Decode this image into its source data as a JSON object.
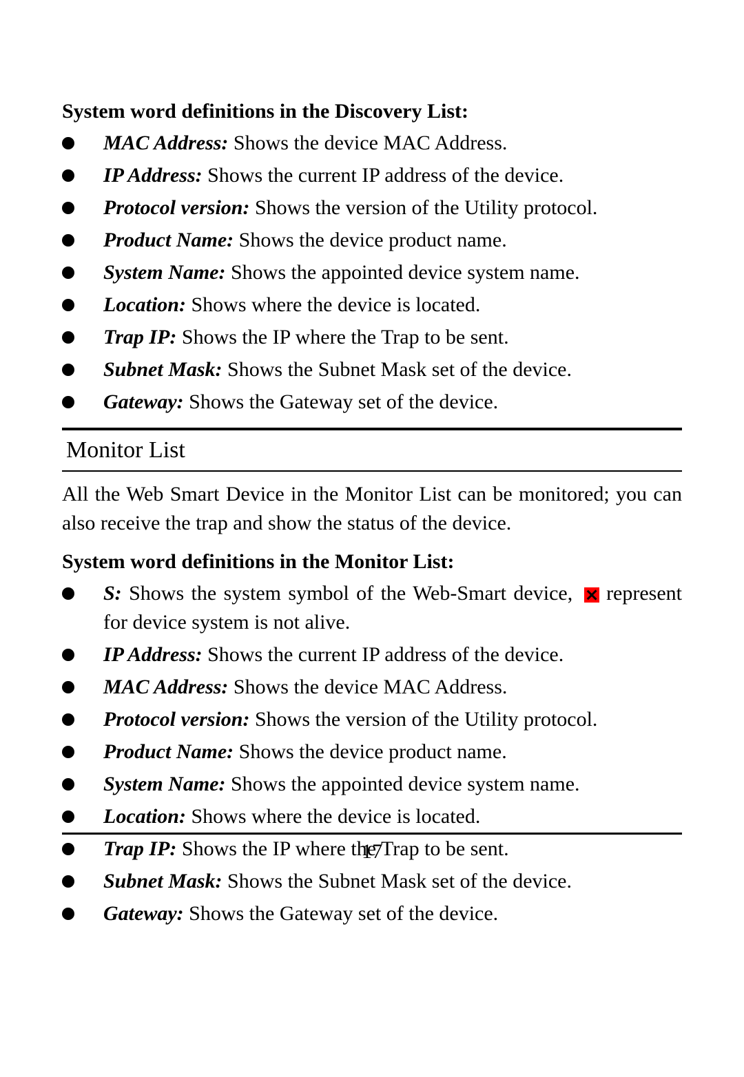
{
  "section1": {
    "title": "System word definitions in the Discovery List:",
    "items": [
      {
        "term": "MAC Address:",
        "desc": " Shows the device MAC Address."
      },
      {
        "term": "IP Address:",
        "desc": " Shows the current IP address of the device."
      },
      {
        "term": "Protocol version:",
        "desc": " Shows the version of the Utility protocol."
      },
      {
        "term": "Product Name:",
        "desc": " Shows the device product name."
      },
      {
        "term": "System Name:",
        "desc": " Shows the appointed device system name."
      },
      {
        "term": "Location:",
        "desc": " Shows where the device is located."
      },
      {
        "term": "Trap IP:",
        "desc": " Shows the IP where the Trap to be sent."
      },
      {
        "term": "Subnet Mask:",
        "desc": " Shows the Subnet Mask set of the device."
      },
      {
        "term": "Gateway:",
        "desc": " Shows the Gateway set of the device."
      }
    ]
  },
  "heading": "Monitor List",
  "intro": "All the Web Smart Device in the Monitor List can be monitored; you can also receive the trap and show the status of the device.",
  "section2": {
    "title": "System word definitions in the Monitor List:",
    "items": [
      {
        "term": "S:",
        "desc_before": " Shows the system symbol of the Web-Smart device, ",
        "desc_after": " represent for device system is not alive.",
        "has_icon": true
      },
      {
        "term": "IP Address:",
        "desc": " Shows the current IP address of the device."
      },
      {
        "term": "MAC Address:",
        "desc": " Shows the device MAC Address."
      },
      {
        "term": "Protocol version:",
        "desc": " Shows the version of the Utility protocol."
      },
      {
        "term": "Product Name:",
        "desc": " Shows the device product name."
      },
      {
        "term": "System Name:",
        "desc": " Shows the appointed device system name."
      },
      {
        "term": "Location:",
        "desc": " Shows where the device is located."
      },
      {
        "term": "Trap IP:",
        "desc": " Shows the IP where the Trap to be sent."
      },
      {
        "term": "Subnet Mask:",
        "desc": " Shows the Subnet Mask set of the device."
      },
      {
        "term": "Gateway:",
        "desc": " Shows the Gateway set of the device."
      }
    ]
  },
  "page_number": "17"
}
